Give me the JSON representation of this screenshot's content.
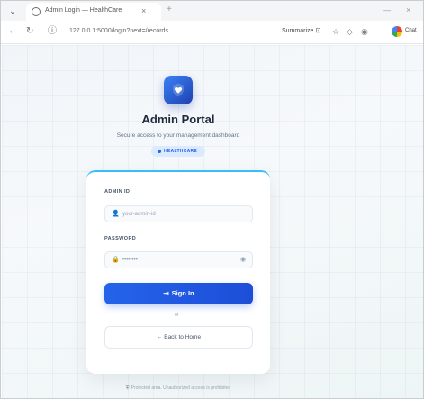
{
  "browser": {
    "tab_title": "Admin Login — HealthCare",
    "tab_close": "×",
    "new_tab": "+",
    "minimize": "—",
    "close": "×",
    "url": "127.0.0.1:5000/login?next=/records",
    "summarize_label": "Summarize",
    "chat_label": "Chat",
    "icons": [
      "back-arrow-icon",
      "reload-icon",
      "info-icon",
      "summarize-icon",
      "bookmark-icon",
      "extensions-icon",
      "profile-icon",
      "more-icon"
    ]
  },
  "page": {
    "logo_icon": "heart-shield-icon",
    "title": "Admin Portal",
    "subtitle": "Secure access to your management dashboard",
    "badge": "HEALTHCARE",
    "card": {
      "admin_id_label": "ADMIN ID",
      "admin_id_placeholder": "your-admin-id",
      "password_label": "PASSWORD",
      "password_value": "••••••••",
      "signin_label": "Sign In",
      "or_text": "or",
      "back_label": "Back to Home"
    },
    "footer": "Protected area. Unauthorized access is prohibited"
  },
  "colors": {
    "accent": "#2563eb",
    "title": "#1e293b",
    "card_top_border": "#38bdf8"
  }
}
